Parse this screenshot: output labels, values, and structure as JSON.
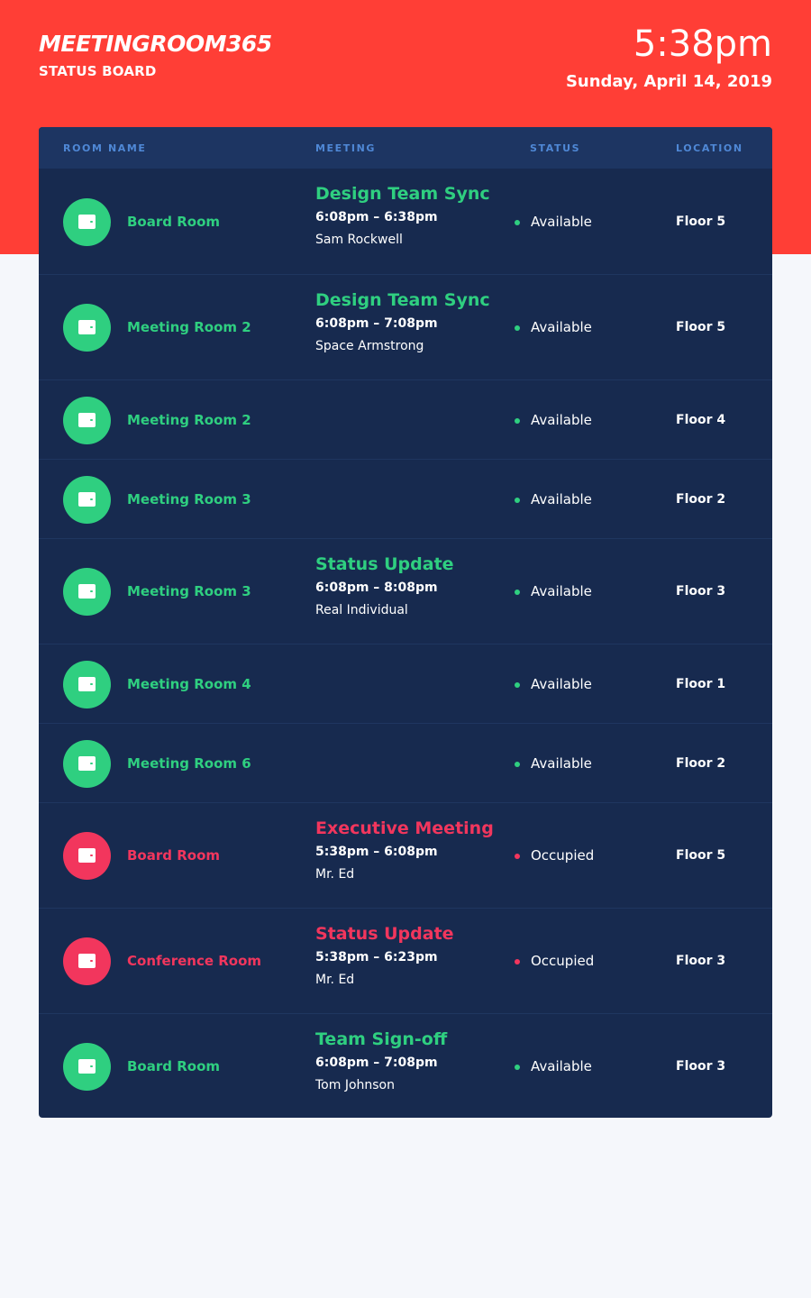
{
  "header": {
    "logo": "MEETINGROOM365",
    "subtitle": "STATUS BOARD",
    "time": "5:38pm",
    "date": "Sunday, April 14, 2019"
  },
  "table": {
    "columns": [
      "ROOM NAME",
      "MEETING",
      "STATUS",
      "LOCATION"
    ],
    "rows": [
      {
        "room": "Board Room",
        "state": "available",
        "meeting": {
          "title": "Design Team Sync",
          "time": "6:08pm – 6:38pm",
          "host": "Sam Rockwell"
        },
        "status": "Available",
        "location": "Floor 5"
      },
      {
        "room": "Meeting Room 2",
        "state": "available",
        "meeting": {
          "title": "Design Team Sync",
          "time": "6:08pm – 7:08pm",
          "host": "Space Armstrong"
        },
        "status": "Available",
        "location": "Floor 5"
      },
      {
        "room": "Meeting Room 2",
        "state": "available",
        "meeting": null,
        "status": "Available",
        "location": "Floor 4"
      },
      {
        "room": "Meeting Room 3",
        "state": "available",
        "meeting": null,
        "status": "Available",
        "location": "Floor 2"
      },
      {
        "room": "Meeting Room 3",
        "state": "available",
        "meeting": {
          "title": "Status Update",
          "time": "6:08pm – 8:08pm",
          "host": "Real Individual"
        },
        "status": "Available",
        "location": "Floor 3"
      },
      {
        "room": "Meeting Room 4",
        "state": "available",
        "meeting": null,
        "status": "Available",
        "location": "Floor 1"
      },
      {
        "room": "Meeting Room 6",
        "state": "available",
        "meeting": null,
        "status": "Available",
        "location": "Floor 2"
      },
      {
        "room": "Board Room",
        "state": "occupied",
        "meeting": {
          "title": "Executive Meeting",
          "time": "5:38pm – 6:08pm",
          "host": "Mr. Ed"
        },
        "status": "Occupied",
        "location": "Floor 5"
      },
      {
        "room": "Conference Room",
        "state": "occupied",
        "meeting": {
          "title": "Status Update",
          "time": "5:38pm – 6:23pm",
          "host": "Mr. Ed"
        },
        "status": "Occupied",
        "location": "Floor 3"
      },
      {
        "room": "Board Room",
        "state": "available",
        "meeting": {
          "title": "Team Sign-off",
          "time": "6:08pm – 7:08pm",
          "host": "Tom Johnson"
        },
        "status": "Available",
        "location": "Floor 3"
      }
    ]
  },
  "colors": {
    "header_bg": "#ff3e36",
    "panel_bg": "#172a4f",
    "available": "#2fcf80",
    "occupied": "#f2365d"
  },
  "icons": {
    "room": "door-icon",
    "status": "status-dot-icon"
  }
}
